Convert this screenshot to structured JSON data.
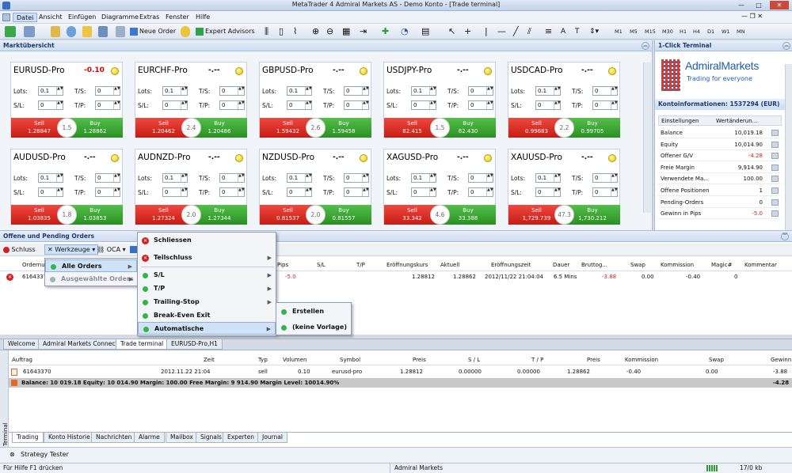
{
  "window": {
    "title": "MetaTrader 4 Admiral Markets AS - Demo Konto - [Trade terminal]",
    "min": "—",
    "max": "□",
    "close": "✕"
  },
  "menu": [
    "Datei",
    "Ansicht",
    "Einfügen",
    "Diagramme",
    "Extras",
    "Fenster",
    "Hilfe"
  ],
  "toolbar": {
    "new_order": "Neue Order",
    "expert_advisors": "Expert Advisors",
    "timeframes": [
      "M1",
      "M5",
      "M15",
      "M30",
      "H1",
      "H4",
      "D1",
      "W1",
      "MN"
    ]
  },
  "market": {
    "title": "Marktübersicht",
    "labels": {
      "lots": "Lots:",
      "ts": "T/S:",
      "sl": "S/L:",
      "tp": "T/P:",
      "sell": "Sell",
      "buy": "Buy"
    },
    "cards": [
      {
        "symbol": "EURUSD-Pro",
        "change": "-0.10",
        "lots": "0.1",
        "ts": "0",
        "sl": "0",
        "tp": "0",
        "sell": "1.28847",
        "buy": "1.28862",
        "spread": "1.5"
      },
      {
        "symbol": "EURCHF-Pro",
        "change": "-.--",
        "lots": "0.1",
        "ts": "0",
        "sl": "0",
        "tp": "0",
        "sell": "1.20462",
        "buy": "1.20486",
        "spread": "2.4"
      },
      {
        "symbol": "GBPUSD-Pro",
        "change": "-.--",
        "lots": "0.1",
        "ts": "0",
        "sl": "0",
        "tp": "0",
        "sell": "1.59432",
        "buy": "1.59458",
        "spread": "2.6"
      },
      {
        "symbol": "USDJPY-Pro",
        "change": "-.--",
        "lots": "0.1",
        "ts": "0",
        "sl": "0",
        "tp": "0",
        "sell": "82.415",
        "buy": "82.430",
        "spread": "1.5"
      },
      {
        "symbol": "USDCAD-Pro",
        "change": "-.--",
        "lots": "0.1",
        "ts": "0",
        "sl": "0",
        "tp": "0",
        "sell": "0.99683",
        "buy": "0.99705",
        "spread": "2.2"
      },
      {
        "symbol": "AUDUSD-Pro",
        "change": "-.--",
        "lots": "0.1",
        "ts": "0",
        "sl": "0",
        "tp": "0",
        "sell": "1.03835",
        "buy": "1.03853",
        "spread": "1.8"
      },
      {
        "symbol": "AUDNZD-Pro",
        "change": "-.--",
        "lots": "0.1",
        "ts": "0",
        "sl": "0",
        "tp": "0",
        "sell": "1.27324",
        "buy": "1.27344",
        "spread": "2.0"
      },
      {
        "symbol": "NZDUSD-Pro",
        "change": "-.--",
        "lots": "0.1",
        "ts": "0",
        "sl": "0",
        "tp": "0",
        "sell": "0.81537",
        "buy": "0.81557",
        "spread": "2.0"
      },
      {
        "symbol": "XAGUSD-Pro",
        "change": "-.--",
        "lots": "0.1",
        "ts": "0",
        "sl": "0",
        "tp": "0",
        "sell": "33.342",
        "buy": "33.388",
        "spread": "4.6"
      },
      {
        "symbol": "XAUUSD-Pro",
        "change": "-.--",
        "lots": "0.1",
        "ts": "0",
        "sl": "0",
        "tp": "0",
        "sell": "1,729.739",
        "buy": "1,730.212",
        "spread": "47.3"
      }
    ]
  },
  "oneclick": {
    "title": "1-Click Terminal",
    "brand": "AdmiralMarkets",
    "tagline": "Trading for everyone",
    "account_title": "Kontoinformationen: 1537294 (EUR)",
    "col1": "Einstellungen",
    "col2": "Wertänderun...",
    "rows": [
      {
        "label": "Balance",
        "value": "10,019.18"
      },
      {
        "label": "Equity",
        "value": "10,014.90"
      },
      {
        "label": "Offener G/V",
        "value": "-4.28"
      },
      {
        "label": "Freie Margin",
        "value": "9,914.90"
      },
      {
        "label": "Verwendete Ma...",
        "value": "100.00"
      },
      {
        "label": "Offene Positionen",
        "value": "1"
      },
      {
        "label": "Pending-Orders",
        "value": "0"
      },
      {
        "label": "Gewinn in Pips",
        "value": "-5.0"
      }
    ]
  },
  "orders": {
    "title": "Offene und Pending Orders",
    "btn_close": "Schluss",
    "btn_tools": "Werkzeuge",
    "btn_oca": "OCA",
    "headers": [
      "Ordernu...",
      "Pips",
      "S/L",
      "T/P",
      "Eröffnungskurs",
      "Aktuell",
      "Eröffnungszeit",
      "Dauer",
      "Bruttog...",
      "Swap",
      "Kommission",
      "Magic#",
      "Kommentar"
    ],
    "row": {
      "order": "61643370",
      "pips": "-5.0",
      "open": "1.28812",
      "current": "1.28862",
      "time": "2012/11/22 21:04:04",
      "duration": "6.5 Mins",
      "gross": "-3.88",
      "swap": "0.00",
      "commission": "-0.40",
      "magic": "0"
    }
  },
  "menu1": {
    "all": "Alle Orders",
    "selected": "Ausgewählte Orders"
  },
  "menu2": {
    "close": "Schliessen",
    "partial": "Teilschluss",
    "sl": "S/L",
    "tp": "T/P",
    "trailing": "Trailing-Stop",
    "breakeven": "Break-Even Exit",
    "auto": "Automatische Positionsschliessung"
  },
  "menu3": {
    "create": "Erstellen",
    "none": "(keine Vorlage)"
  },
  "doctabs": [
    "Welcome",
    "Admiral Markets Connect",
    "Trade terminal",
    "EURUSD-Pro,H1"
  ],
  "terminal": {
    "side_label": "Terminal",
    "headers": [
      "Auftrag",
      "Zeit",
      "Typ",
      "Volumen",
      "Symbol",
      "Preis",
      "S / L",
      "T / P",
      "Preis",
      "Kommission",
      "Swap",
      "Gewinn"
    ],
    "row": {
      "order": "61643370",
      "time": "2012.11.22 21:04",
      "type": "sell",
      "volume": "0.10",
      "symbol": "eurusd-pro",
      "price": "1.28812",
      "sl": "0.00000",
      "tp": "0.00000",
      "cprice": "1.28862",
      "commission": "-0.40",
      "swap": "0.00",
      "profit": "-3.88"
    },
    "balance_line": "Balance: 10 019.18  Equity: 10 014.90  Margin: 100.00  Free Margin: 9 914.90  Margin Level: 10014.90%",
    "balance_profit": "-4.28",
    "tabs": [
      "Trading",
      "Konto Historie",
      "Nachrichten",
      "Alarme",
      "Mailbox",
      "Signals",
      "Experten",
      "Journal"
    ]
  },
  "strategy_tester": "Strategy Tester",
  "status": {
    "help": "Für Hilfe F1 drücken",
    "broker": "Admiral Markets",
    "traffic": "17/0 kb"
  },
  "colors": {
    "sell": "#d42a22",
    "buy": "#38a830",
    "brand": "#1f5fa8"
  }
}
